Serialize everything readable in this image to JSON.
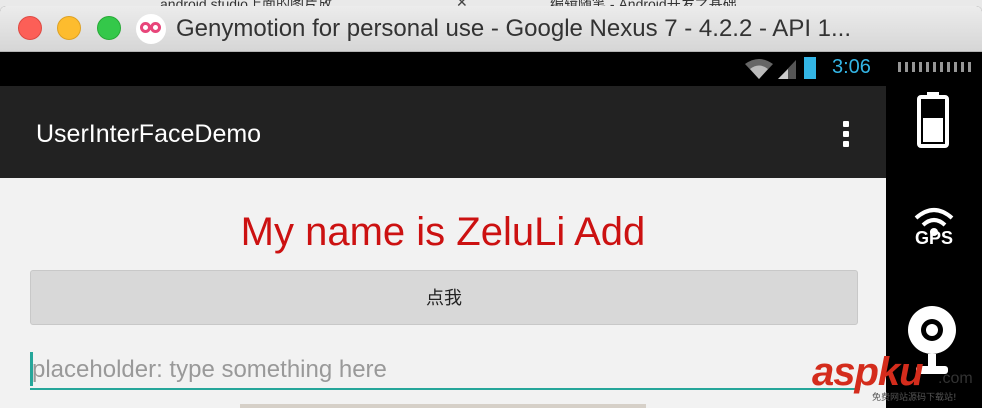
{
  "browser_tabs": [
    {
      "label": "android studio上面的图片放",
      "close": "✕"
    },
    {
      "label": "编辑随笔 - Android开发之基础",
      "close": "✕"
    }
  ],
  "window": {
    "title": "Genymotion for personal use - Google Nexus 7 - 4.2.2 - API 1..."
  },
  "status_bar": {
    "time": "3:06",
    "accent_color": "#33b5e5"
  },
  "action_bar": {
    "app_title": "UserInterFaceDemo",
    "overflow_icon": "overflow-menu-icon"
  },
  "content": {
    "headline": "My name is ZeluLi  Add",
    "headline_color": "#cc1111",
    "button_label": "点我",
    "input": {
      "value": "",
      "placeholder": "placeholder: type something here"
    },
    "accent_color": "#26a69a"
  },
  "side_panel": {
    "items": [
      {
        "icon": "battery-icon"
      },
      {
        "icon": "gps-icon",
        "label": "GPS"
      },
      {
        "icon": "webcam-icon"
      }
    ]
  },
  "watermark": {
    "text": "aspku",
    "suffix": ".com",
    "subtitle": "免费网站源码下载站!"
  }
}
